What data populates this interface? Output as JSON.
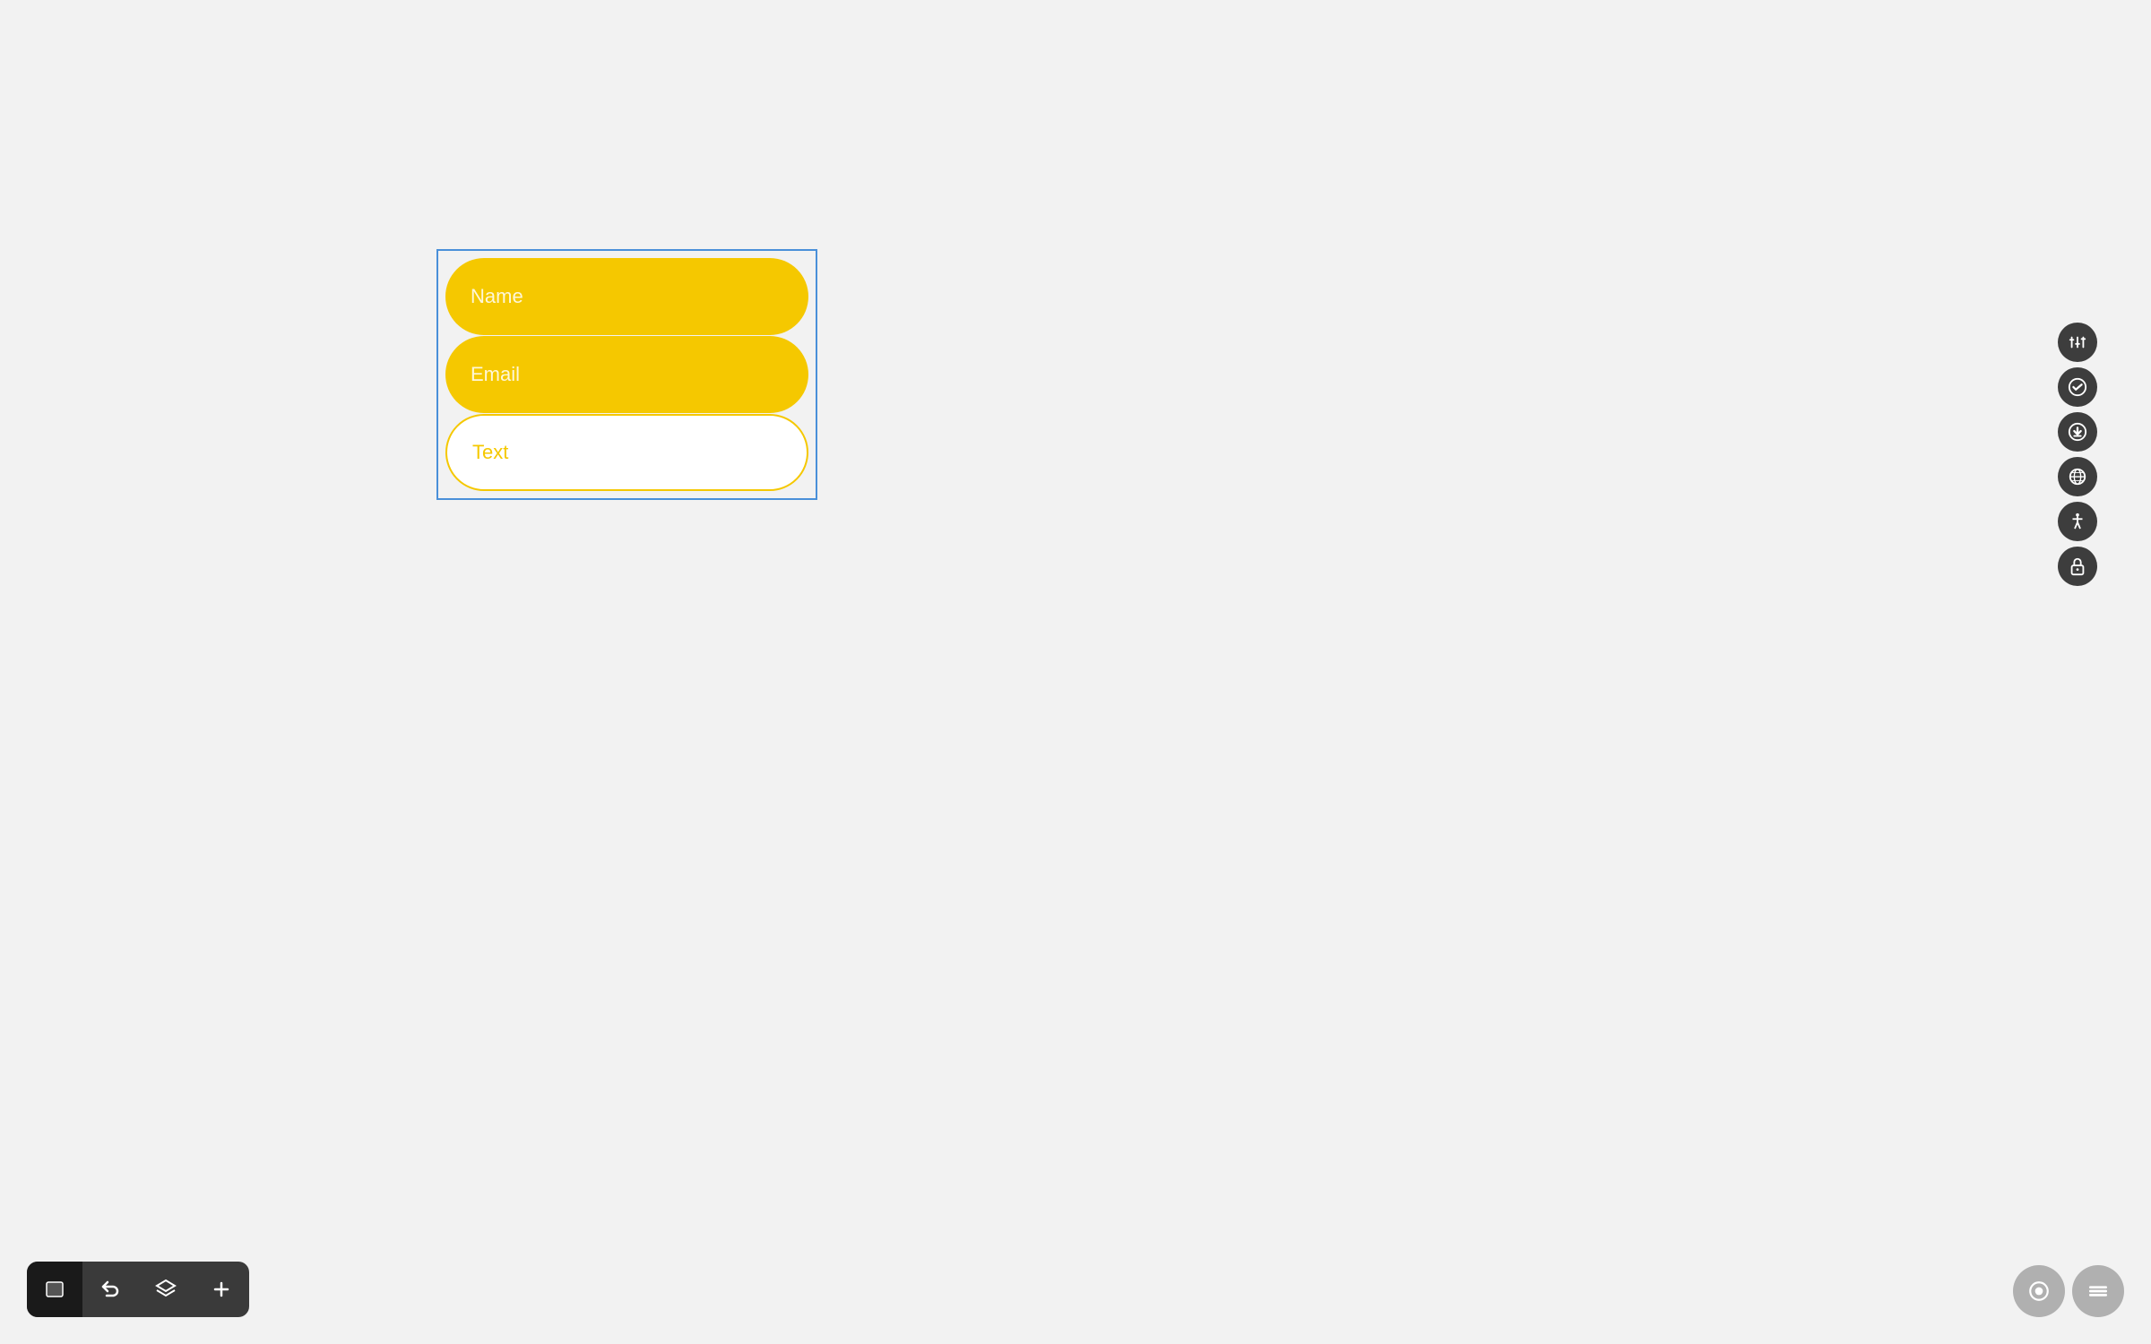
{
  "canvas": {
    "background": "#f2f2f2"
  },
  "form": {
    "fields": [
      {
        "label": "Name",
        "type": "filled",
        "bg": "#f5c800",
        "textColor": "rgba(255,255,255,0.85)"
      },
      {
        "label": "Email",
        "type": "filled",
        "bg": "#f5c800",
        "textColor": "rgba(255,255,255,0.85)"
      },
      {
        "label": "Text",
        "type": "outline",
        "bg": "#ffffff",
        "textColor": "#f5c800"
      }
    ]
  },
  "right_toolbar": {
    "buttons": [
      {
        "name": "sliders",
        "icon": "⊞",
        "label": "Sliders"
      },
      {
        "name": "check",
        "icon": "✓",
        "label": "Check"
      },
      {
        "name": "download",
        "icon": "↓",
        "label": "Download"
      },
      {
        "name": "globe",
        "icon": "⊕",
        "label": "Globe"
      },
      {
        "name": "accessibility",
        "icon": "♿",
        "label": "Accessibility"
      },
      {
        "name": "lock",
        "icon": "🔒",
        "label": "Lock"
      }
    ]
  },
  "bottom_toolbar": {
    "buttons": [
      {
        "name": "layers-active",
        "icon": "▣",
        "label": "Layers Active"
      },
      {
        "name": "undo",
        "icon": "↩",
        "label": "Undo"
      },
      {
        "name": "layers",
        "icon": "⊟",
        "label": "Layers"
      },
      {
        "name": "add",
        "icon": "+",
        "label": "Add"
      }
    ]
  },
  "bottom_right": {
    "buttons": [
      {
        "name": "preview",
        "icon": "◉",
        "label": "Preview"
      },
      {
        "name": "menu",
        "icon": "≡",
        "label": "Menu"
      }
    ]
  }
}
